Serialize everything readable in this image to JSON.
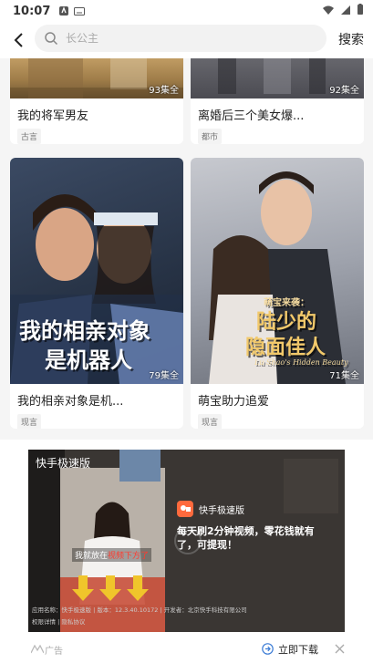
{
  "status": {
    "time": "10:07"
  },
  "search": {
    "placeholder": "长公主",
    "button_label": "搜索"
  },
  "cards": [
    {
      "title": "我的将军男友",
      "tag": "古言",
      "episodes": "93集全"
    },
    {
      "title": "离婚后三个美女爆...",
      "tag": "都市",
      "episodes": "92集全"
    },
    {
      "title": "我的相亲对象是机...",
      "tag": "现言",
      "episodes": "79集全",
      "poster_text_1": "我的相亲对象",
      "poster_text_2": "是机器人"
    },
    {
      "title": "萌宝助力追爱",
      "tag": "现言",
      "episodes": "71集全",
      "poster_text_small": "萌宝来袭：",
      "poster_text_1": "陆少的",
      "poster_text_2": "隐面佳人",
      "poster_text_en": "Lu Shao's Hidden Beauty"
    }
  ],
  "ad": {
    "brand_label": "快手极速版",
    "app_name": "快手极速版",
    "headline": "每天刷2分钟视频，零花钱就有了，可提现！",
    "caption_prefix": "我就放在",
    "caption_highlight": "视频下方了",
    "info_line": "应用名称：快手极速版 | 版本：12.3.40.10172 | 开发者：北京快手科技有限公司",
    "info_line2": "权限详情 | 隐私协议",
    "ad_label": "广告",
    "download_label": "立即下载",
    "colors": {
      "accent": "#ff6a3d"
    }
  }
}
